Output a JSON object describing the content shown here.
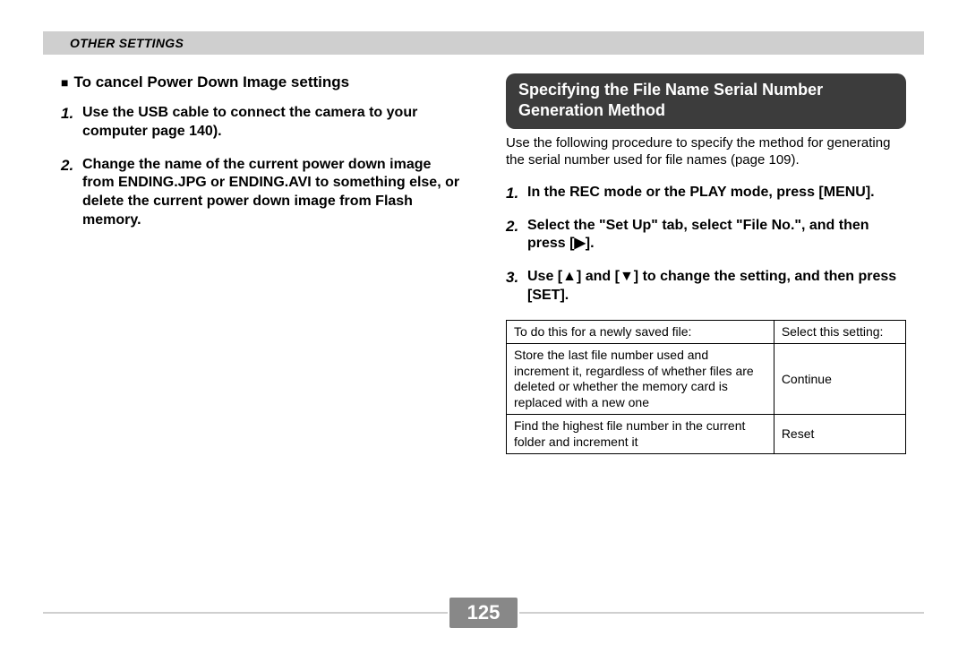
{
  "header": {
    "title": "OTHER SETTINGS"
  },
  "left": {
    "heading": "To cancel Power Down Image settings",
    "steps": [
      "Use the USB cable to connect the camera to your computer page 140).",
      "Change the name of the current power down image from ENDING.JPG or ENDING.AVI to something else, or delete the current power down image from Flash memory."
    ]
  },
  "right": {
    "section_title": "Specifying the File Name Serial Number Generation Method",
    "intro": "Use the following procedure to specify the method for generating the serial number used for file names (page 109).",
    "steps": [
      "In the REC mode or the PLAY mode, press [MENU].",
      "Select the \"Set Up\" tab, select \"File No.\", and then press [▶].",
      "Use [▲] and [▼] to change the setting, and then press [SET]."
    ],
    "table": {
      "headers": [
        "To do this for a newly saved file:",
        "Select this setting:"
      ],
      "rows": [
        [
          "Store the last file number used and increment it, regardless of whether files are deleted or whether the memory card is replaced with a new one",
          "Continue"
        ],
        [
          "Find the highest file number in the current folder and increment it",
          "Reset"
        ]
      ]
    }
  },
  "page_number": "125"
}
